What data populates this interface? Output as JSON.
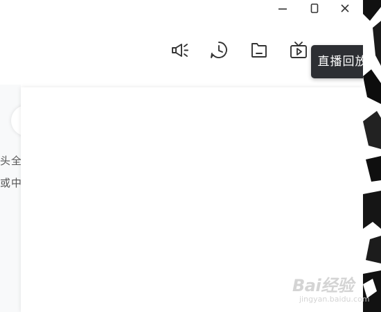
{
  "window_controls": {
    "minimize_icon": "minimize-icon",
    "maximize_icon": "maximize-icon",
    "close_icon": "close-icon"
  },
  "toolbar": {
    "items": [
      {
        "icon": "megaphone-icon"
      },
      {
        "icon": "clock-icon"
      },
      {
        "icon": "folder-icon"
      },
      {
        "icon": "tv-play-icon"
      }
    ]
  },
  "tooltip": {
    "text": "直播回放"
  },
  "left_panel": {
    "line1": "头全",
    "line2": "或中"
  },
  "watermark": {
    "logo": "Bai经验",
    "sub": "jingyan.baidu.com"
  },
  "colors": {
    "tooltip_bg": "#2d2f33",
    "icon_stroke": "#333333",
    "panel_bg": "#f3f4f6"
  }
}
